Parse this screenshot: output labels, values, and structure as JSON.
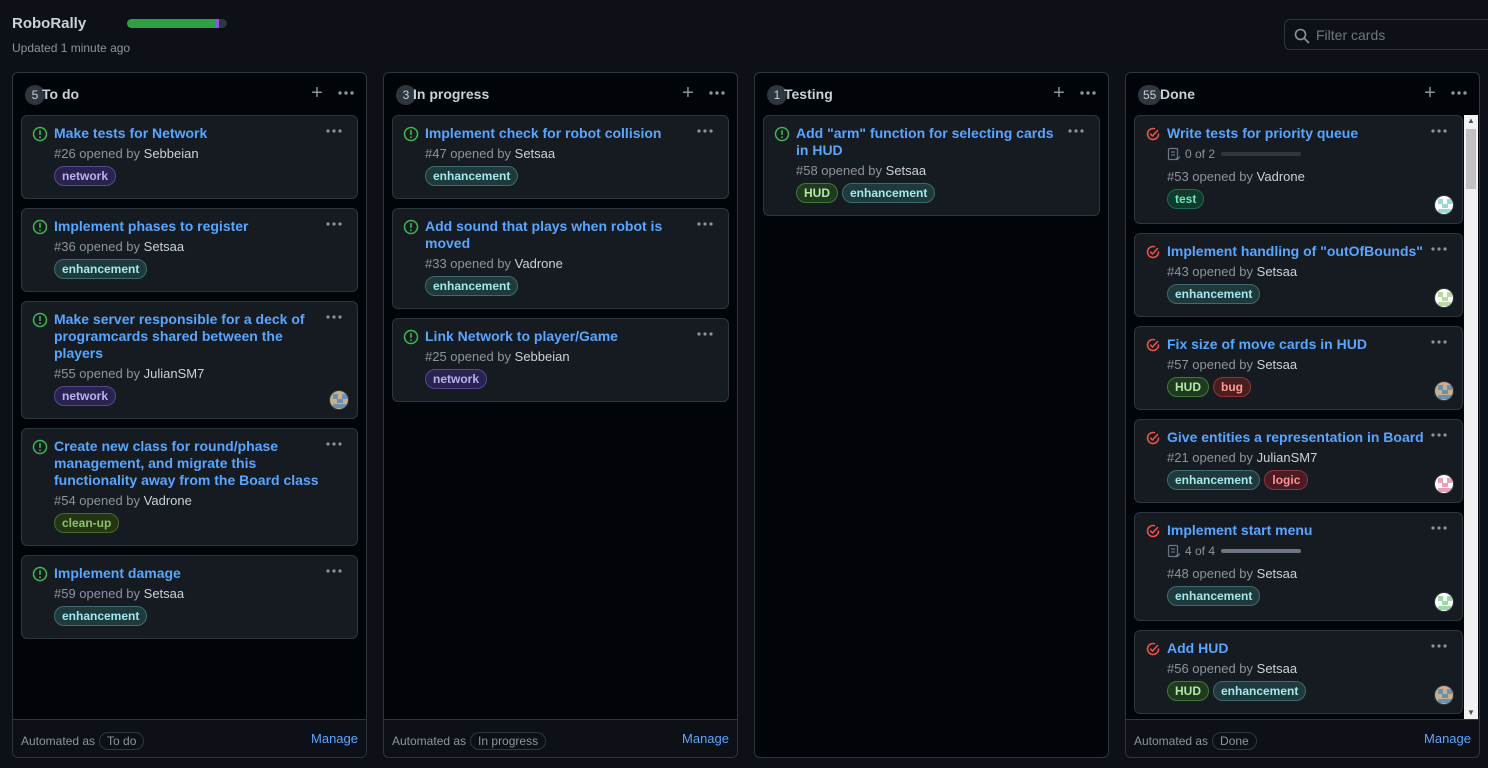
{
  "project": {
    "title": "RoboRally",
    "updated": "Updated 1 minute ago",
    "progress": {
      "done_pct": 88,
      "in_progress_pct": 4
    },
    "filter_placeholder": "Filter cards"
  },
  "columns": [
    {
      "name": "To do",
      "count": "5",
      "automated_label": "Automated as",
      "automated_value": "To do",
      "manage": "Manage",
      "cards": [
        {
          "title": "Make tests for Network",
          "number": "#26 opened by",
          "author": "Sebbeian",
          "labels": [
            "network"
          ]
        },
        {
          "title": "Implement phases to register",
          "number": "#36 opened by",
          "author": "Setsaa",
          "labels": [
            "enhancement"
          ]
        },
        {
          "title": "Make server responsible for a deck of programcards shared between the players",
          "number": "#55 opened by",
          "author": "JulianSM7",
          "labels": [
            "network"
          ],
          "avatar": true
        },
        {
          "title": "Create new class for round/phase management, and migrate this functionality away from the Board class",
          "number": "#54 opened by",
          "author": "Vadrone",
          "labels": [
            "clean-up"
          ]
        },
        {
          "title": "Implement damage",
          "number": "#59 opened by",
          "author": "Setsaa",
          "labels": [
            "enhancement"
          ]
        }
      ]
    },
    {
      "name": "In progress",
      "count": "3",
      "automated_label": "Automated as",
      "automated_value": "In progress",
      "manage": "Manage",
      "cards": [
        {
          "title": "Implement check for robot collision",
          "number": "#47 opened by",
          "author": "Setsaa",
          "labels": [
            "enhancement"
          ]
        },
        {
          "title": "Add sound that plays when robot is moved",
          "number": "#33 opened by",
          "author": "Vadrone",
          "labels": [
            "enhancement"
          ]
        },
        {
          "title": "Link Network to player/Game",
          "number": "#25 opened by",
          "author": "Sebbeian",
          "labels": [
            "network"
          ]
        }
      ]
    },
    {
      "name": "Testing",
      "count": "1",
      "cards": [
        {
          "title": "Add \"arm\" function for selecting cards in HUD",
          "number": "#58 opened by",
          "author": "Setsaa",
          "labels": [
            "HUD",
            "enhancement"
          ]
        }
      ]
    },
    {
      "name": "Done",
      "count": "55",
      "automated_label": "Automated as",
      "automated_value": "Done",
      "manage": "Manage",
      "cards": [
        {
          "title": "Write tests for priority queue",
          "tasks": "0 of 2",
          "tasks_done": 0,
          "number": "#53 opened by",
          "author": "Vadrone",
          "labels": [
            "test"
          ],
          "avatar": true
        },
        {
          "title": "Implement handling of \"outOfBounds\"",
          "number": "#43 opened by",
          "author": "Setsaa",
          "labels": [
            "enhancement"
          ],
          "avatar": true
        },
        {
          "title": "Fix size of move cards in HUD",
          "number": "#57 opened by",
          "author": "Setsaa",
          "labels": [
            "HUD",
            "bug"
          ],
          "avatar": true
        },
        {
          "title": "Give entities a representation in Board",
          "number": "#21 opened by",
          "author": "JulianSM7",
          "labels": [
            "enhancement",
            "logic"
          ],
          "avatar": true
        },
        {
          "title": "Implement start menu",
          "tasks": "4 of 4",
          "tasks_done": 1,
          "number": "#48 opened by",
          "author": "Setsaa",
          "labels": [
            "enhancement"
          ],
          "avatar": true
        },
        {
          "title": "Add HUD",
          "number": "#56 opened by",
          "author": "Setsaa",
          "labels": [
            "HUD",
            "enhancement"
          ],
          "avatar": true
        }
      ]
    }
  ],
  "colors": {
    "background": "#0d1117",
    "link": "#58a6ff",
    "open_issue": "#3fb950",
    "closed_issue": "#f85149"
  }
}
